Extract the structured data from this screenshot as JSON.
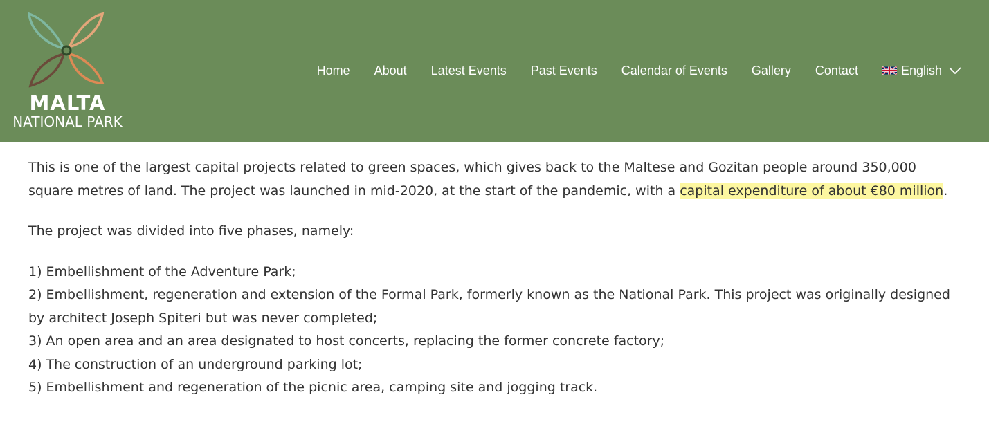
{
  "header": {
    "logo": {
      "title": "MALTA",
      "subtitle": "NATIONAL PARK"
    },
    "nav": {
      "items": [
        {
          "label": "Home"
        },
        {
          "label": "About"
        },
        {
          "label": "Latest Events"
        },
        {
          "label": "Past Events"
        },
        {
          "label": "Calendar of Events"
        },
        {
          "label": "Gallery"
        },
        {
          "label": "Contact"
        }
      ],
      "language": {
        "label": "English",
        "flag_icon": "uk-flag-icon",
        "dropdown_icon": "chevron-down-icon"
      }
    },
    "background_color": "#6b8c59"
  },
  "content": {
    "intro_part1": "This is one of the largest capital projects related to green spaces, which gives back to the Maltese and Gozitan people around 350,000 square metres of land. The project was launched in mid-2020, at the start of the pandemic, with a ",
    "intro_highlight": "capital expenditure of about €80 million",
    "intro_part2": ".",
    "phases_intro": "The project was divided into five phases, namely:",
    "phases": [
      "1) Embellishment of the Adventure Park;",
      "2) Embellishment, regeneration and extension of the Formal Park, formerly known as the National Park. This project was originally designed by architect Joseph Spiteri but was never completed;",
      "3) An open area and an area designated to host concerts, replacing the former concrete factory;",
      "4) The construction of an underground parking lot;",
      "5) Embellishment and regeneration of the picnic area, camping site and jogging track."
    ],
    "highlight_color": "#fdf7a0"
  }
}
